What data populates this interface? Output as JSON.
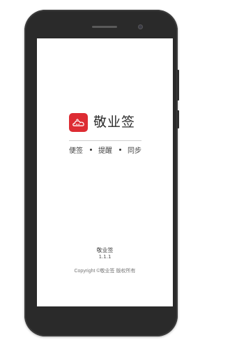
{
  "app": {
    "name": "敬业签",
    "icon": "cloud-icon",
    "brand_color": "#dd2c33"
  },
  "tagline": {
    "items": [
      "便签",
      "提醒",
      "同步"
    ]
  },
  "about": {
    "app_name": "敬业签",
    "version": "1.1.1",
    "copyright": "Copyright ©敬业签 版权所有"
  }
}
